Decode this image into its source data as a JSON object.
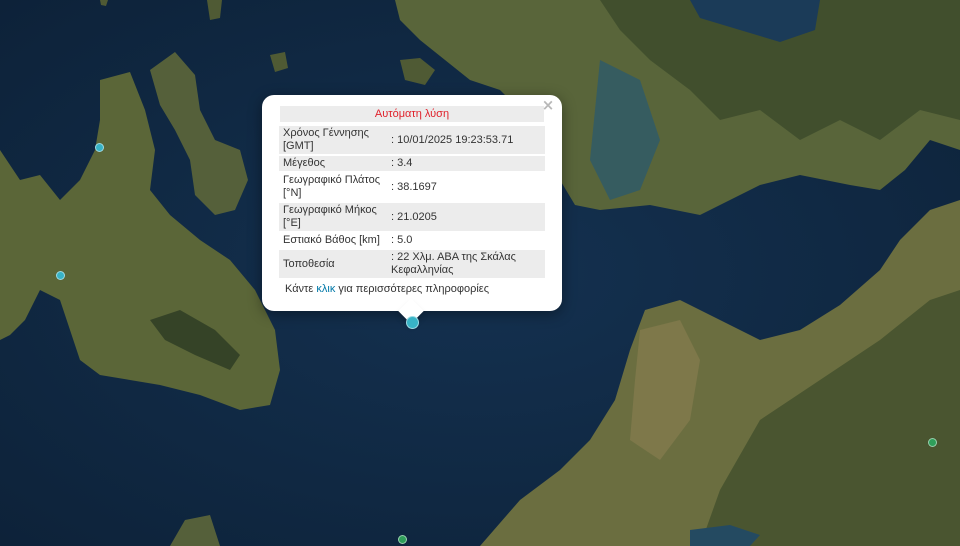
{
  "popup": {
    "title": "Αυτόματη λύση",
    "close_symbol": "×",
    "rows": [
      {
        "label": "Χρόνος Γέννησης [GMT]",
        "value": ": 10/01/2025 19:23:53.71"
      },
      {
        "label": "Μέγεθος",
        "value": ": 3.4"
      },
      {
        "label": "Γεωγραφικό Πλάτος [°N]",
        "value": ": 38.1697"
      },
      {
        "label": "Γεωγραφικό Μήκος [°E]",
        "value": ": 21.0205"
      },
      {
        "label": "Εστιακό Βάθος [km]",
        "value": ": 5.0"
      },
      {
        "label": "Τοποθεσία",
        "value": ": 22 Χλμ. ΑΒΑ της Σκάλας Κεφαλληνίας"
      }
    ],
    "more_prefix": "Κάντε",
    "more_link": "κλικ",
    "more_suffix": "για περισσότερες πληροφορίες"
  },
  "colors": {
    "sea": "#10283f",
    "land": "#5f6b3c",
    "mountain": "#3e4b2a",
    "popup_title": "#e0212b",
    "link": "#0078a8",
    "quake_cyan": "#38b3c6",
    "quake_green": "#2f9e5a"
  },
  "markers": [
    {
      "name": "selected-quake-marker",
      "color": "#38b3c6"
    },
    {
      "name": "quake-marker",
      "color": "#38b3c6"
    },
    {
      "name": "quake-marker",
      "color": "#38b3c6"
    },
    {
      "name": "quake-marker",
      "color": "#2f9e5a"
    },
    {
      "name": "quake-marker",
      "color": "#2f9e5a"
    }
  ]
}
